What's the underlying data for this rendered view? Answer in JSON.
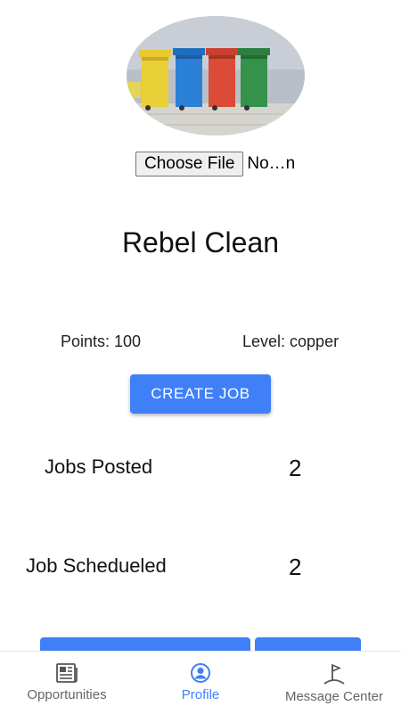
{
  "profile": {
    "image_icon": "recycling-bins-photo",
    "file_button_label": "Choose File",
    "file_name": "No…n",
    "name": "Rebel Clean",
    "points_text": "Points: 100",
    "level_text": "Level: copper"
  },
  "actions": {
    "create_job_label": "CREATE JOB"
  },
  "stats": [
    {
      "label": "Jobs Posted",
      "value": "2"
    },
    {
      "label": "Job Schedueled",
      "value": "2"
    }
  ],
  "nav": {
    "items": [
      {
        "label": "Opportunities",
        "icon": "newspaper-icon",
        "active": false
      },
      {
        "label": "Profile",
        "icon": "account-circle-icon",
        "active": true
      },
      {
        "label": "Message Center",
        "icon": "flag-icon",
        "active": false
      }
    ]
  },
  "colors": {
    "accent": "#3f80f8",
    "nav_inactive": "#666666"
  }
}
